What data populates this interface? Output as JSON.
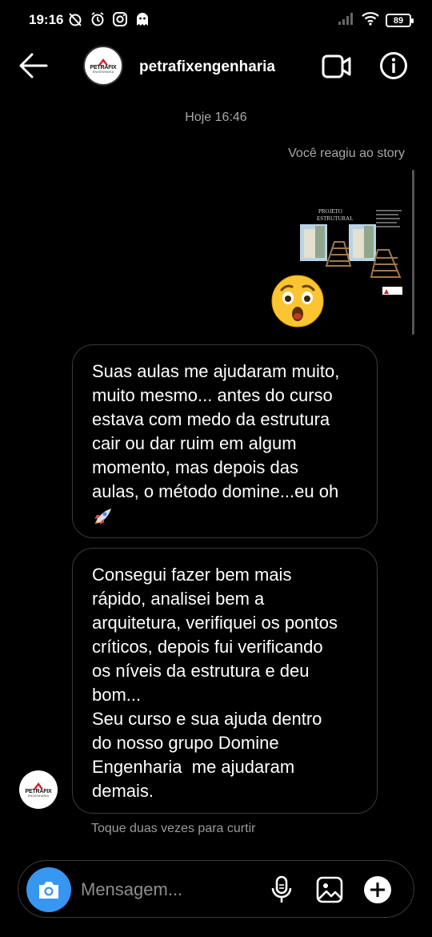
{
  "status_bar": {
    "time": "19:16",
    "battery": "89",
    "icons": [
      "alarm-off-icon",
      "alarm-icon",
      "instagram-icon",
      "ghost-icon",
      "signal-icon",
      "wifi-icon",
      "battery-icon"
    ]
  },
  "header": {
    "username": "petrafixengenharia",
    "avatar_logo_text": "PETRAFIX",
    "avatar_logo_sub": "ENGENHARIA",
    "icons": [
      "back-arrow-icon",
      "video-call-icon",
      "info-icon"
    ]
  },
  "chat": {
    "timestamp": "Hoje 16:46",
    "reaction_note": "Você reagiu ao story",
    "story_thumb": {
      "title_line1": "PROJETO",
      "title_line2": "ESTRUTURAL"
    },
    "reaction_emoji": "astonished-face-icon",
    "messages": [
      {
        "text": "Suas aulas me ajudaram muito,\nmuito mesmo... antes do curso\nestava com medo da estrutura\ncair ou dar ruim em algum\nmomento, mas depois das\naulas, o método domine...eu oh\n",
        "trailing_icon": "rocket-icon"
      },
      {
        "text": "Consegui fazer bem mais\nrápido, analisei bem a\narquitetura, verifiquei os pontos\ncríticos, depois fui verificando\nos níveis da estrutura e deu\nbom...\nSeu curso e sua ajuda dentro\ndo nosso grupo Domine\nEngenharia  me ajudaram\ndemais."
      }
    ],
    "like_hint": "Toque duas vezes para curtir"
  },
  "composer": {
    "placeholder": "Mensagem...",
    "icons": [
      "camera-icon",
      "microphone-icon",
      "gallery-icon",
      "plus-icon"
    ]
  },
  "colors": {
    "background": "#000000",
    "accent_blue": "#3797f0",
    "muted_text": "#a8a8a8",
    "bubble_border": "#3a3a3a"
  }
}
